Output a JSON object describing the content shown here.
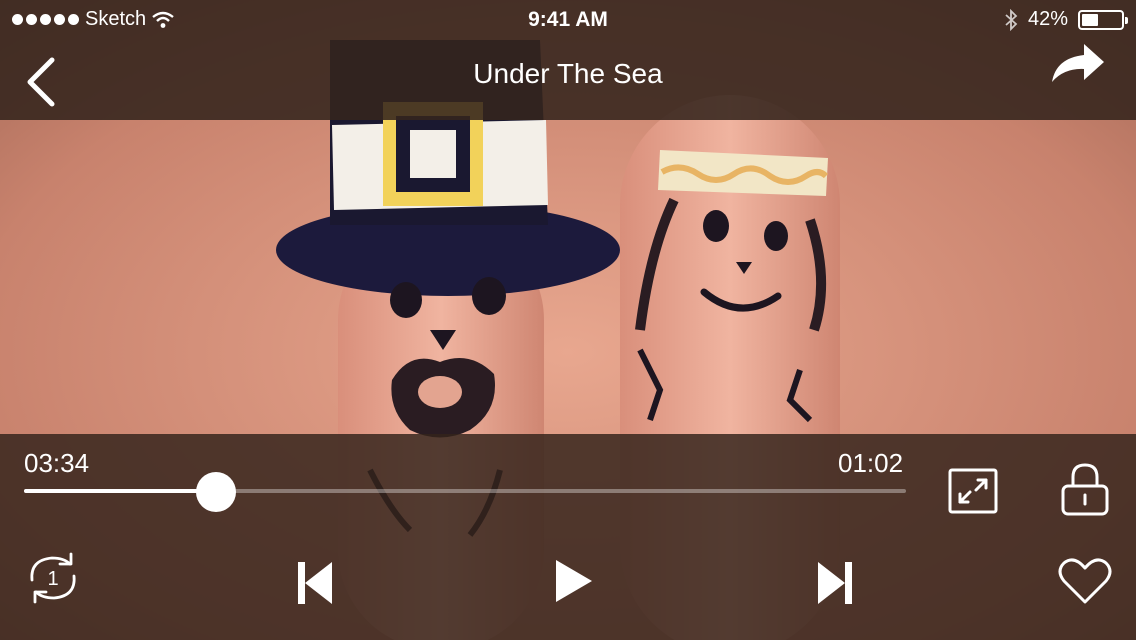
{
  "status_bar": {
    "carrier": "Sketch",
    "time": "9:41 AM",
    "battery_percent": "42%",
    "battery_level": 0.42,
    "signal_bars": 5
  },
  "nav": {
    "title": "Under The Sea",
    "back_icon": "chevron-left-icon",
    "share_icon": "share-arrow-icon"
  },
  "player": {
    "time_elapsed": "03:34",
    "time_remaining": "01:02",
    "progress": 0.218,
    "controls": {
      "fullscreen_icon": "expand-icon",
      "lock_icon": "lock-icon",
      "repeat_icon": "repeat-one-icon",
      "repeat_count": "1",
      "previous_icon": "skip-previous-icon",
      "play_icon": "play-icon",
      "next_icon": "skip-next-icon",
      "favorite_icon": "heart-icon"
    }
  },
  "colors": {
    "overlay": "#34241c",
    "accent": "#ffffff"
  }
}
